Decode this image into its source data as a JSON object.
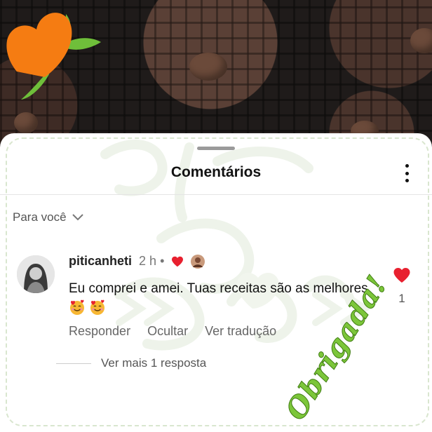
{
  "header": {
    "title": "Comentários"
  },
  "filter": {
    "label": "Para você"
  },
  "comment": {
    "username": "piticanheti",
    "time": "2 h",
    "separator": "•",
    "text": "Eu comprei e amei. Tuas receitas são as melhores",
    "like_count": "1",
    "actions": {
      "reply": "Responder",
      "hide": "Ocultar",
      "translate": "Ver tradução"
    },
    "view_replies": "Ver mais 1 resposta"
  },
  "overlay": {
    "stamp_text": "Obrigada!"
  },
  "colors": {
    "accent_like": "#e8202f",
    "brand_orange": "#f57c12",
    "brand_green": "#6fbf3a",
    "stamp_green": "#7cc63a"
  },
  "icons": [
    "heart-logo-icon",
    "more-options-icon",
    "chevron-down-icon",
    "heart-icon",
    "smiling-face-with-hearts-icon"
  ]
}
